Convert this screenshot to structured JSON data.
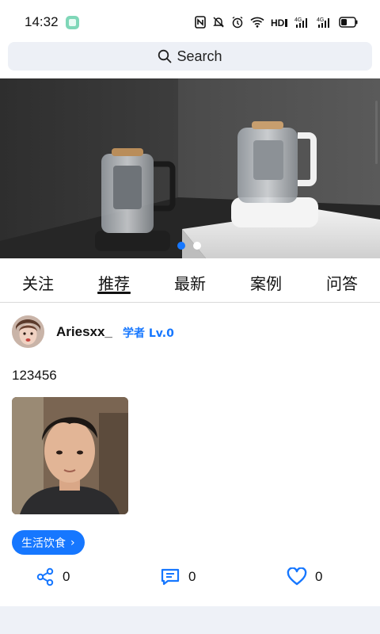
{
  "status_bar": {
    "time": "14:32",
    "signal_label": "HD"
  },
  "search": {
    "label": "Search"
  },
  "banner": {
    "slide_count": 2,
    "active_slide": 0
  },
  "tabs": [
    {
      "label": "关注"
    },
    {
      "label": "推荐"
    },
    {
      "label": "最新"
    },
    {
      "label": "案例"
    },
    {
      "label": "问答"
    }
  ],
  "post": {
    "username": "Ariesxx_",
    "level": "学者 Lv.0",
    "text": "123456",
    "tag": "生活饮食",
    "tag_chevron": "›",
    "share_count": "0",
    "comment_count": "0",
    "like_count": "0"
  },
  "colors": {
    "accent": "#1677ff",
    "search_bg": "#edf0f6",
    "band_bg": "#eef1f7"
  }
}
